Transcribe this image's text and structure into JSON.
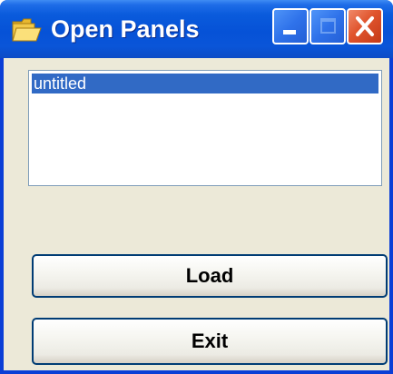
{
  "window": {
    "title": "Open Panels",
    "icon": "folder-icon",
    "controls": {
      "minimize": "minimize-icon",
      "maximize": "maximize-icon",
      "close": "close-icon"
    }
  },
  "panel_list": {
    "items": [
      {
        "label": "untitled",
        "selected": true
      }
    ]
  },
  "buttons": {
    "load_label": "Load",
    "exit_label": "Exit"
  },
  "colors": {
    "titlebar": "#0652d7",
    "selection": "#316ac5",
    "close_button": "#e0542d",
    "window_bg": "#ece9d8"
  }
}
